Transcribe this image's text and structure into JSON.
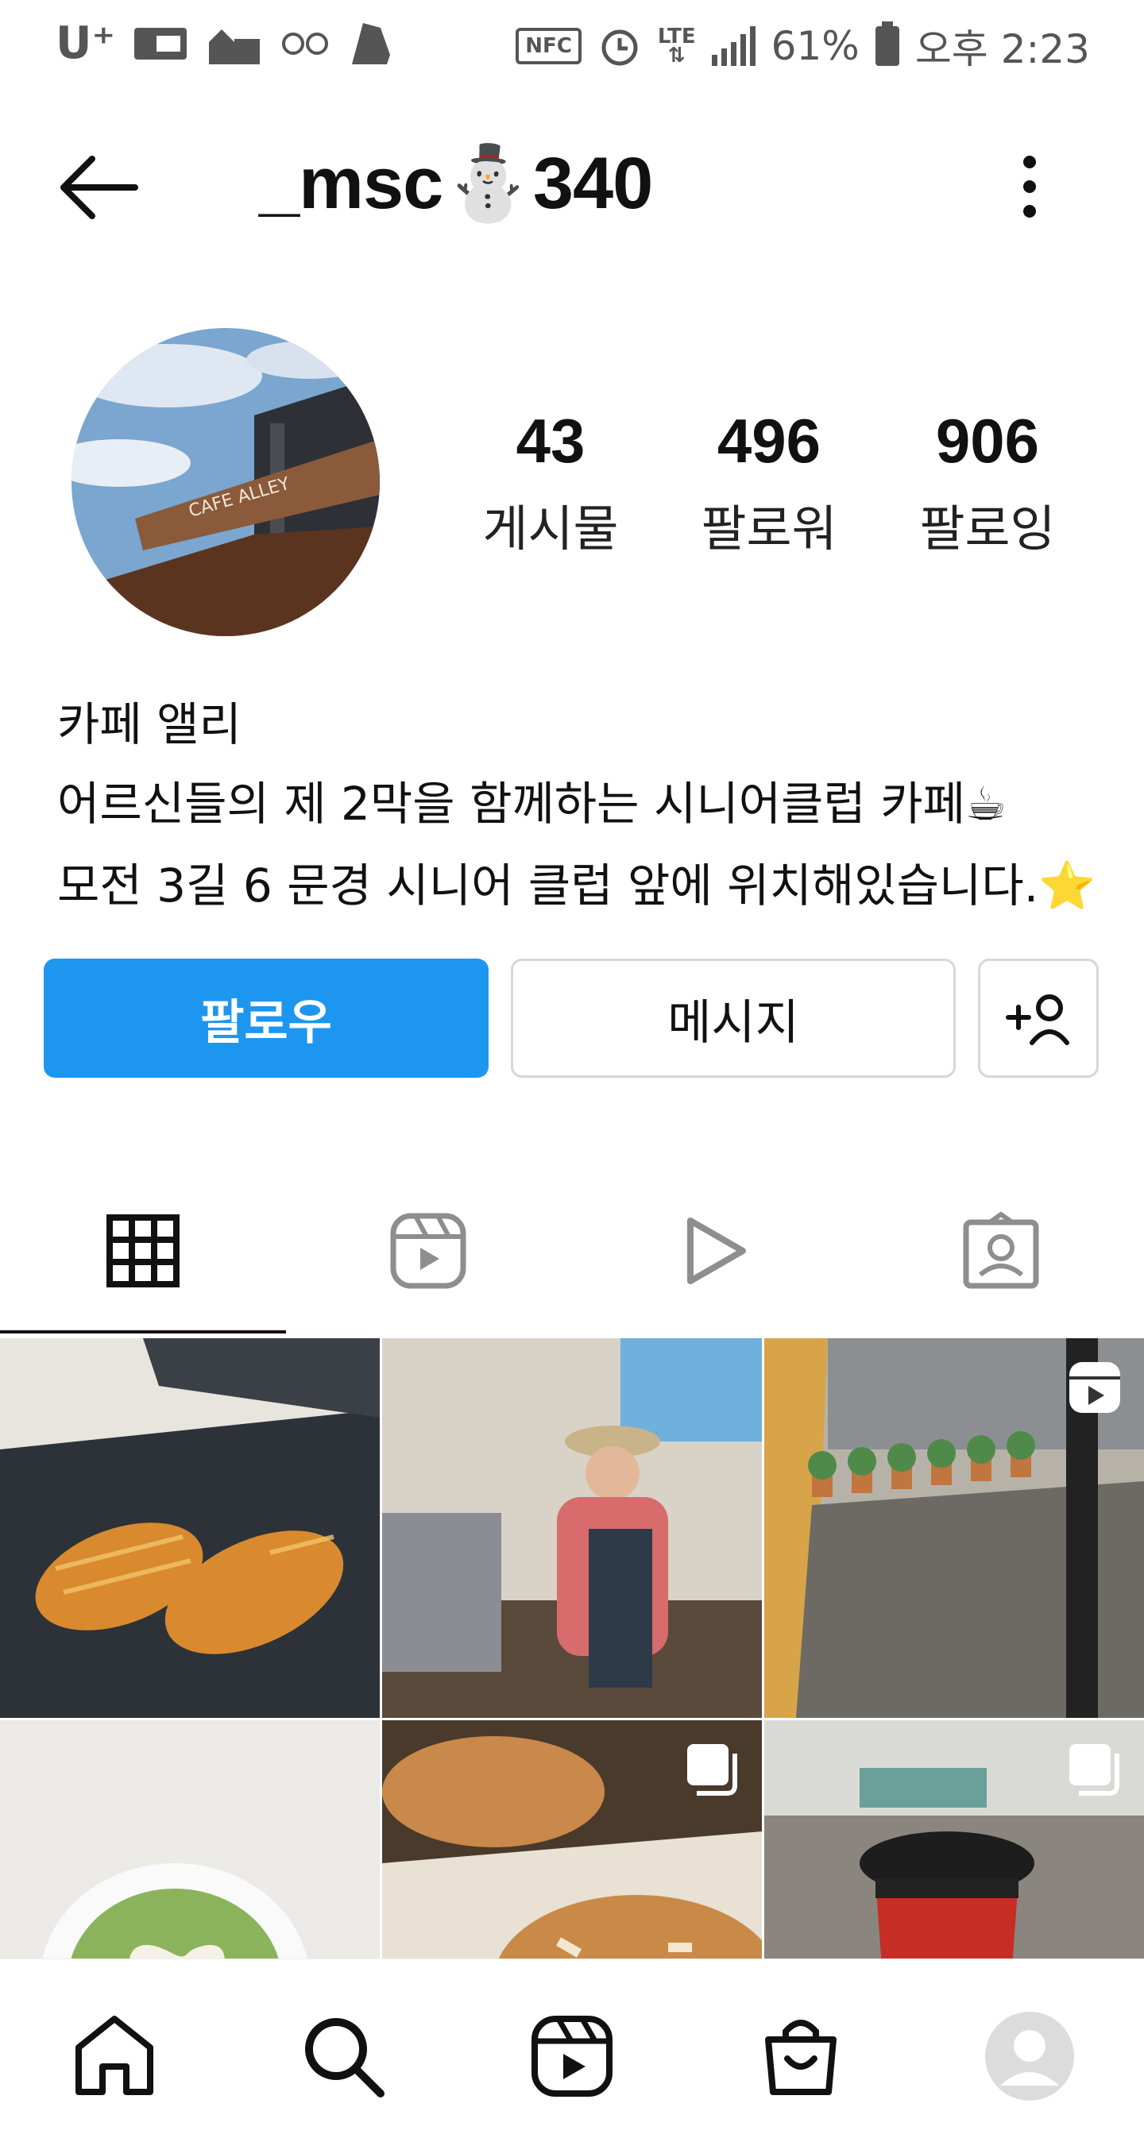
{
  "status_bar": {
    "carrier": "U⁺",
    "nfc": "NFC",
    "lte": "LTE",
    "battery": "61%",
    "time": "오후 2:23"
  },
  "header": {
    "username": "_msc⛄340",
    "back_icon": "arrow-left-icon",
    "more_icon": "vertical-dots-icon"
  },
  "profile": {
    "avatar_text": "CAFE ALLEY",
    "stats": [
      {
        "value": "43",
        "label": "게시물"
      },
      {
        "value": "496",
        "label": "팔로워"
      },
      {
        "value": "906",
        "label": "팔로잉"
      }
    ],
    "bio": {
      "name": "카페 앨리",
      "line1": "어르신들의 제 2막을 함께하는 시니어클럽 카페☕",
      "line2": "모전 3길 6 문경 시니어 클럽 앞에 위치해있습니다.⭐"
    }
  },
  "actions": {
    "follow": "팔로우",
    "message": "메시지",
    "add_user_icon": "add-person-icon"
  },
  "tabs": [
    "grid-icon",
    "reels-icon",
    "video-icon",
    "tagged-icon"
  ],
  "posts": [
    {
      "subject": "waffles on iron"
    },
    {
      "subject": "barista at espresso machine"
    },
    {
      "subject": "rainy deck with plants",
      "badge": "reels-icon"
    },
    {
      "subject": "matcha latte art"
    },
    {
      "subject": "almond waffles",
      "badge": "carousel-icon"
    },
    {
      "subject": "coffee cup takeaway",
      "badge": "carousel-icon"
    }
  ],
  "bottom_nav": [
    "home-icon",
    "search-icon",
    "reels-icon",
    "shop-icon",
    "profile-avatar"
  ],
  "colors": {
    "accent": "#1d96f0",
    "text": "#111111",
    "border": "#d7d7d7"
  }
}
